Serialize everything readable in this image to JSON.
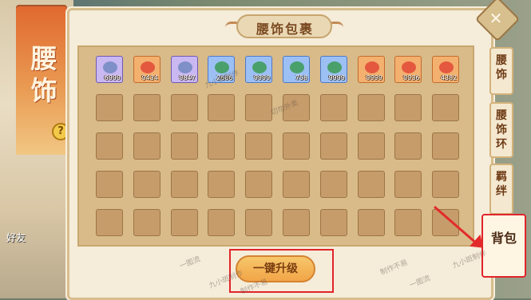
{
  "panel": {
    "title": "腰饰包裹"
  },
  "left": {
    "title": "腰饰",
    "help_icon": "help-icon",
    "bottom_text": "好友"
  },
  "tabs": [
    "腰饰",
    "腰饰环",
    "羁绊"
  ],
  "active_tab": "背包",
  "upgrade_button": "一键升级",
  "close_icon": "close-icon",
  "items": [
    {
      "qty": "6999",
      "color": "purple"
    },
    {
      "qty": "9434",
      "color": "orange"
    },
    {
      "qty": "9847",
      "color": "purple"
    },
    {
      "qty": "2686",
      "color": "blue"
    },
    {
      "qty": "9999",
      "color": "blue"
    },
    {
      "qty": "758",
      "color": "blue"
    },
    {
      "qty": "9999",
      "color": "blue"
    },
    {
      "qty": "9999",
      "color": "orange"
    },
    {
      "qty": "9936",
      "color": "orange"
    },
    {
      "qty": "4382",
      "color": "orange"
    }
  ],
  "watermarks": [
    "九小斑制作",
    "切勿外卖",
    "一图流",
    "九小斑制作",
    "制作不易",
    "一图流",
    "九小斑制作",
    "制作不易"
  ]
}
